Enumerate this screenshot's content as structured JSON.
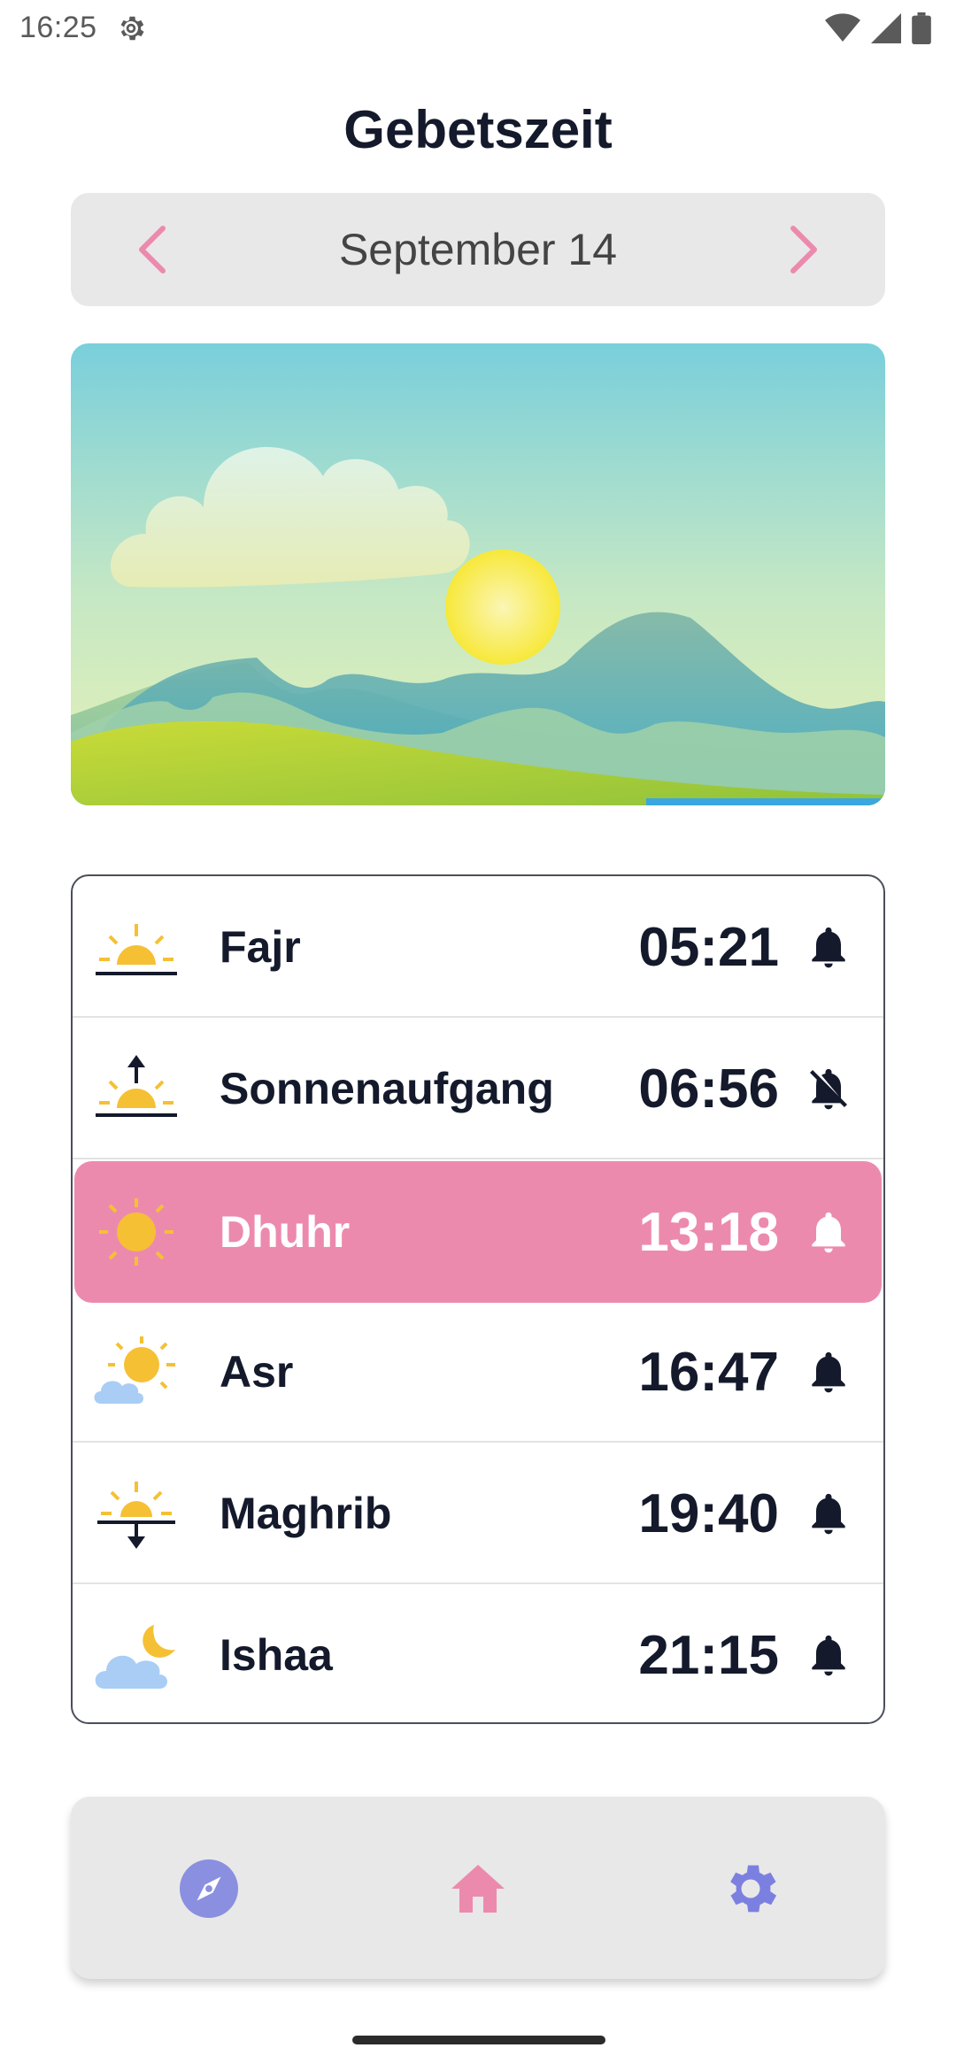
{
  "status_bar": {
    "time": "16:25",
    "icons": [
      "settings-gear-icon",
      "wifi-icon",
      "signal-icon",
      "battery-icon"
    ]
  },
  "title": "Gebetszeit",
  "date_nav": {
    "date": "September 14",
    "prev_icon": "chevron-left-icon",
    "next_icon": "chevron-right-icon",
    "accent_color": "#ec8aae"
  },
  "hero": {
    "image": "landscape-illustration (sky, cloud, sun, mountains, hills)"
  },
  "prayers": [
    {
      "name": "Fajr",
      "time": "05:21",
      "icon": "dawn-sun-icon",
      "bell": "bell-icon",
      "active": false
    },
    {
      "name": "Sonnenaufgang",
      "time": "06:56",
      "icon": "sunrise-icon",
      "bell": "bell-off-icon",
      "active": false
    },
    {
      "name": "Dhuhr",
      "time": "13:18",
      "icon": "sun-icon",
      "bell": "bell-icon",
      "active": true
    },
    {
      "name": "Asr",
      "time": "16:47",
      "icon": "sun-cloud-icon",
      "bell": "bell-icon",
      "active": false
    },
    {
      "name": "Maghrib",
      "time": "19:40",
      "icon": "sunset-icon",
      "bell": "bell-icon",
      "active": false
    },
    {
      "name": "Ishaa",
      "time": "21:15",
      "icon": "moon-cloud-icon",
      "bell": "bell-icon",
      "active": false
    }
  ],
  "colors": {
    "active_row": "#ec8aae",
    "text_dark": "#141a2b",
    "sun_yellow": "#f5c033",
    "nav_compass": "#8a8fe0",
    "nav_home": "#ec8aae",
    "nav_settings": "#7b80e0"
  },
  "bottom_nav": [
    {
      "icon": "compass-icon",
      "selected": false
    },
    {
      "icon": "home-icon",
      "selected": true
    },
    {
      "icon": "settings-icon",
      "selected": false
    }
  ]
}
